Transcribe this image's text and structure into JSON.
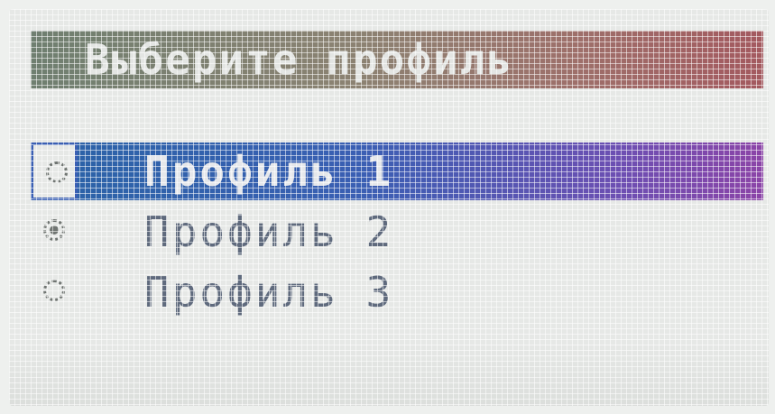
{
  "header": {
    "title": "Выберите профиль"
  },
  "menu": {
    "items": [
      {
        "label": "Профиль 1",
        "highlighted": true,
        "radio_checked": false
      },
      {
        "label": "Профиль 2",
        "highlighted": false,
        "radio_checked": true
      },
      {
        "label": "Профиль 3",
        "highlighted": false,
        "radio_checked": false
      }
    ]
  },
  "colors": {
    "title_bar_start": "#6f7f70",
    "title_bar_end": "#a3595f",
    "selection_start": "#2a63a6",
    "selection_end": "#8b44a7",
    "label_text": "#5f6a7d",
    "background": "#e6e8e6"
  },
  "icons": {
    "radio_unchecked": "radio-unchecked-icon",
    "radio_checked": "radio-checked-icon"
  }
}
